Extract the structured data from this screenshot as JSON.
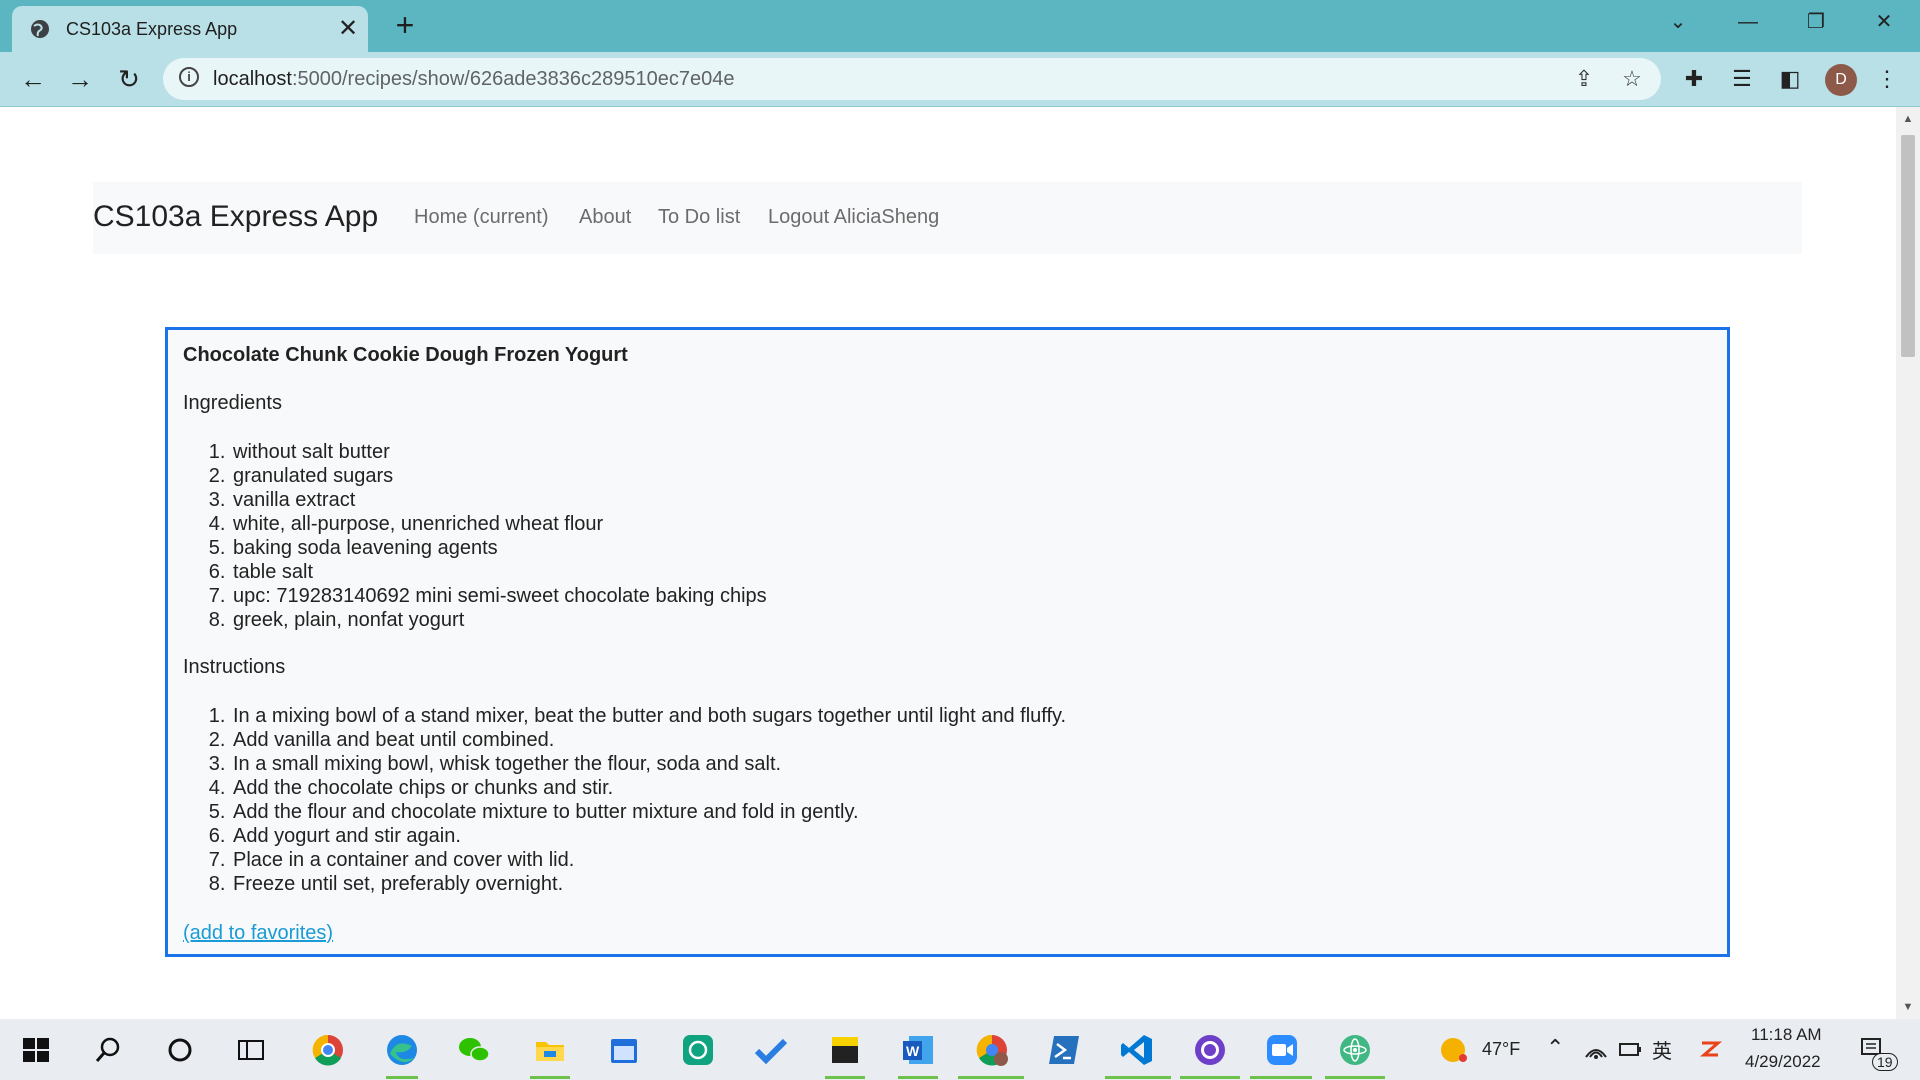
{
  "browser": {
    "tab_title": "CS103a Express App",
    "url_host": "localhost",
    "url_path": ":5000/recipes/show/626ade3836c289510ec7e04e",
    "profile_initial": "D"
  },
  "navbar": {
    "brand": "CS103a Express App",
    "links": [
      {
        "label": "Home (current)"
      },
      {
        "label": "About"
      },
      {
        "label": "To Do list"
      },
      {
        "label": "Logout AliciaSheng"
      }
    ]
  },
  "recipe": {
    "title": "Chocolate Chunk Cookie Dough Frozen Yogurt",
    "ingredients_label": "Ingredients",
    "ingredients": [
      "without salt butter",
      "granulated sugars",
      "vanilla extract",
      "white, all-purpose, unenriched wheat flour",
      "baking soda leavening agents",
      "table salt",
      "upc: 719283140692 mini semi-sweet chocolate baking chips",
      "greek, plain, nonfat yogurt"
    ],
    "instructions_label": "Instructions",
    "instructions": [
      "In a mixing bowl of a stand mixer, beat the butter and both sugars together until light and fluffy.",
      "Add vanilla and beat until combined.",
      "In a small mixing bowl, whisk together the flour, soda and salt.",
      "Add the chocolate chips or chunks and stir.",
      "Add the flour and chocolate mixture to butter mixture and fold in gently.",
      "Add yogurt and stir again.",
      "Place in a container and cover with lid.",
      "Freeze until set, preferably overnight."
    ],
    "favorite_link": "(add to favorites)"
  },
  "taskbar": {
    "weather": "47°F",
    "time": "11:18 AM",
    "date": "4/29/2022",
    "notification_count": "19"
  },
  "colors": {
    "chrome_frame": "#5bb6c1",
    "chrome_toolbar": "#b8e0e6",
    "card_border": "#1a73e8",
    "link": "#1a9bd7",
    "taskbar": "#e9edf2"
  }
}
